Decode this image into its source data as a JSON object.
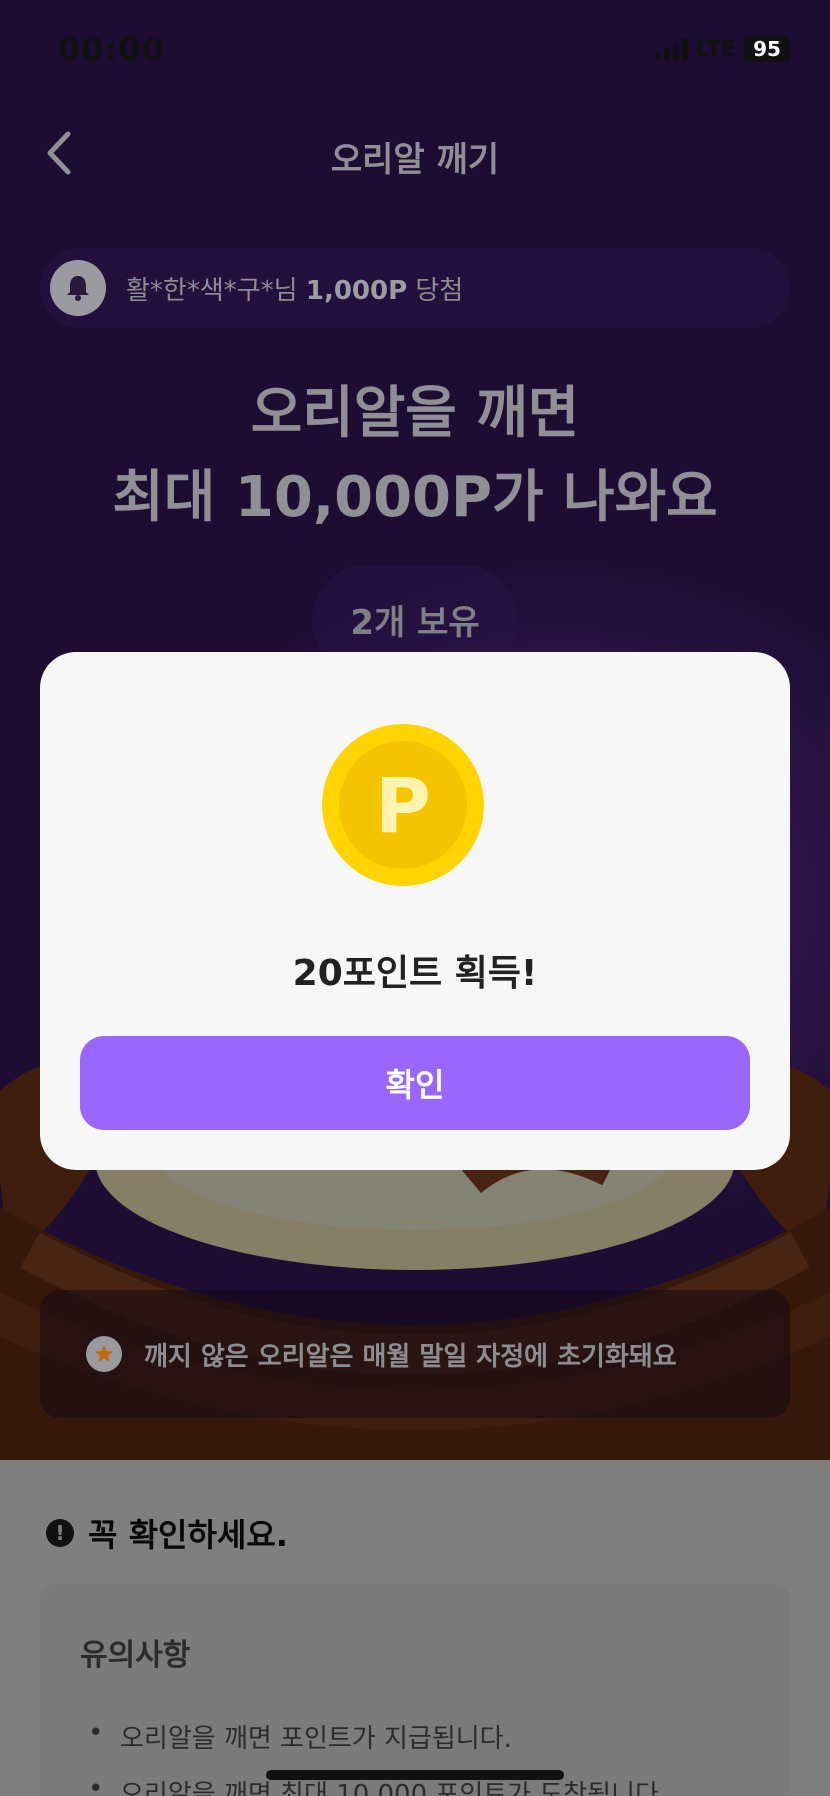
{
  "status_bar": {
    "time": "00:00",
    "network": "LTE",
    "battery": "95"
  },
  "header": {
    "title": "오리알 깨기"
  },
  "ticker": {
    "prefix": "활*한*색*구*님 ",
    "highlight": "1,000P",
    "suffix": " 당첨"
  },
  "headline": {
    "line1": "오리알을 깨면",
    "line2": "최대 10,000P가 나와요"
  },
  "own_count_label": "2개 보유",
  "notice": {
    "text": "깨지 않은 오리알은 매월 말일 자정에 초기화돼요"
  },
  "info": {
    "title": "꼭 확인하세요.",
    "caution_title": "유의사항",
    "items": [
      "오리알을 깨면 포인트가 지급됩니다.",
      "오리알을 깨면 최대 10,000 포인트가 도착됩니다."
    ]
  },
  "modal": {
    "coin_letter": "P",
    "message": "20포인트 획득!",
    "confirm_label": "확인"
  },
  "colors": {
    "accent": "#9966ff",
    "coin_outer": "#ffd400",
    "coin_inner": "#f5c400",
    "purple": "#5b2a8f"
  },
  "icons": {
    "back": "chevron-left-icon",
    "bell": "bell-icon",
    "star": "star-icon",
    "alert": "exclamation-icon",
    "coin": "point-coin-icon"
  }
}
